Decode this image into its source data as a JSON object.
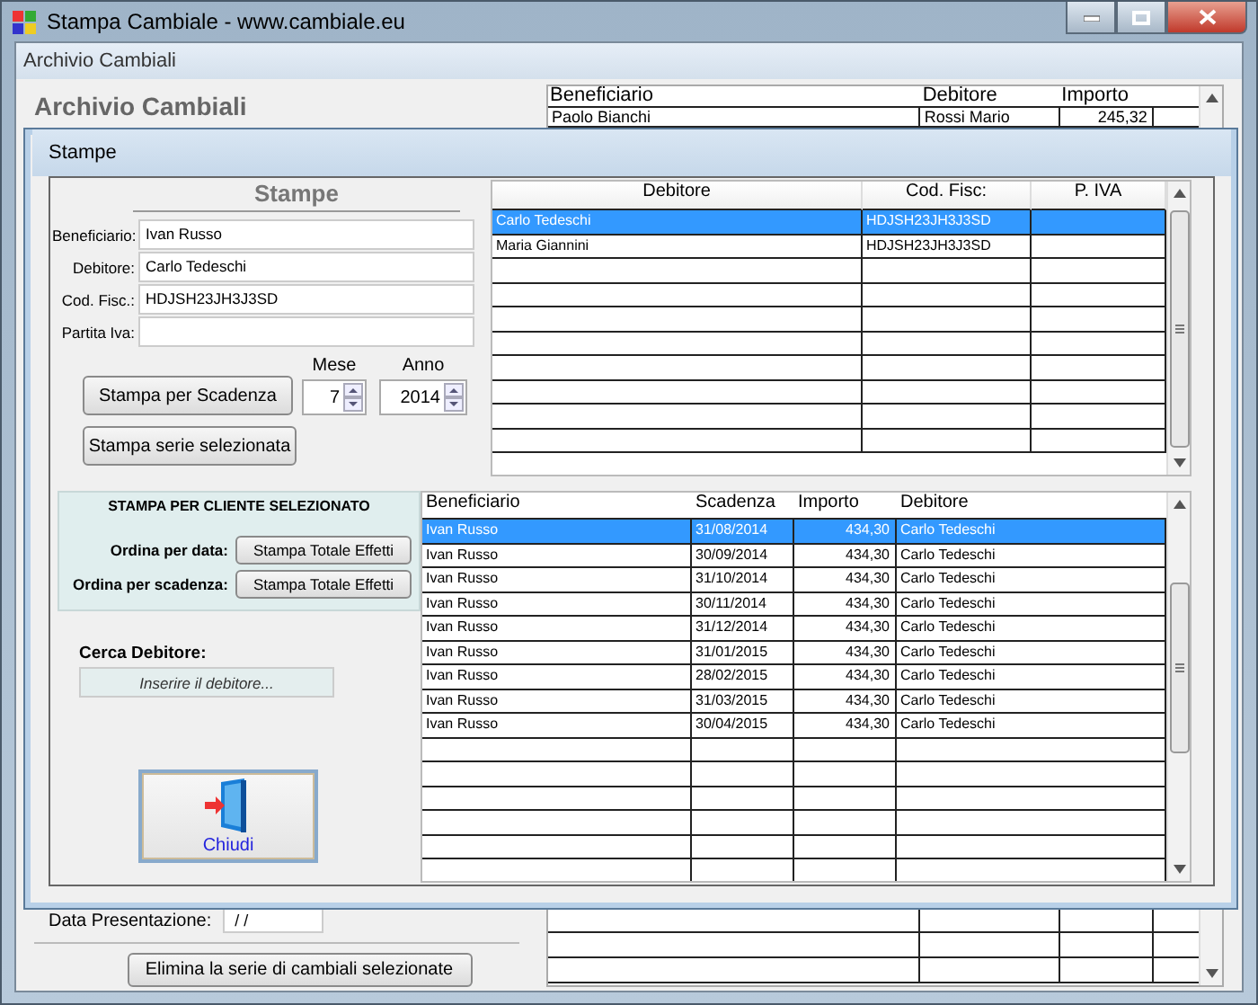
{
  "window": {
    "title": "Stampa Cambiale - www.cambiale.eu"
  },
  "child_window": {
    "title": "Archivio Cambiali",
    "heading": "Archivio Cambiali",
    "archive_table": {
      "columns": [
        "Beneficiario",
        "Debitore",
        "Importo"
      ],
      "rows": [
        {
          "cells": [
            "Paolo Bianchi",
            "Rossi Mario",
            "245,32"
          ]
        }
      ]
    },
    "date_field": {
      "label": "Data Presentazione:",
      "value": "/ /"
    },
    "delete_button": "Elimina la serie di cambiali selezionate"
  },
  "dialog": {
    "title": "Stampe",
    "heading": "Stampe",
    "fields": [
      {
        "label": "Beneficiario:",
        "value": "Ivan Russo"
      },
      {
        "label": "Debitore:",
        "value": "Carlo Tedeschi"
      },
      {
        "label": "Cod. Fisc.:",
        "value": "HDJSH23JH3J3SD"
      },
      {
        "label": "Partita Iva:"
      }
    ],
    "month": {
      "label": "Mese",
      "value": "7"
    },
    "year": {
      "label": "Anno",
      "value": "2014"
    },
    "print_due_button": "Stampa per Scadenza",
    "print_series_button": "Stampa serie selezionata",
    "debtors_table": {
      "columns": [
        "Debitore",
        "Cod. Fisc:",
        "P. IVA"
      ],
      "rows": [
        {
          "cells": [
            "Carlo Tedeschi",
            "HDJSH23JH3J3SD",
            ""
          ],
          "selected": true
        },
        {
          "cells": [
            "Maria Giannini",
            "HDJSH23JH3J3SD",
            ""
          ],
          "selected": false
        }
      ]
    },
    "client_panel": {
      "title": "STAMPA PER CLIENTE SELEZIONATO",
      "rows": [
        {
          "label": "Ordina per data:",
          "button": "Stampa Totale Effetti"
        },
        {
          "label": "Ordina per scadenza:",
          "button": "Stampa Totale Effetti"
        }
      ]
    },
    "search": {
      "label": "Cerca Debitore:",
      "placeholder": "Inserire il debitore..."
    },
    "close_button": "Chiudi",
    "bills_table": {
      "columns": [
        "Beneficiario",
        "Scadenza",
        "Importo",
        "Debitore"
      ],
      "rows": [
        {
          "cells": [
            "Ivan Russo",
            "31/08/2014",
            "434,30",
            "Carlo Tedeschi"
          ],
          "selected": true
        },
        {
          "cells": [
            "Ivan Russo",
            "30/09/2014",
            "434,30",
            "Carlo Tedeschi"
          ],
          "selected": false
        },
        {
          "cells": [
            "Ivan Russo",
            "31/10/2014",
            "434,30",
            "Carlo Tedeschi"
          ],
          "selected": false
        },
        {
          "cells": [
            "Ivan Russo",
            "30/11/2014",
            "434,30",
            "Carlo Tedeschi"
          ],
          "selected": false
        },
        {
          "cells": [
            "Ivan Russo",
            "31/12/2014",
            "434,30",
            "Carlo Tedeschi"
          ],
          "selected": false
        },
        {
          "cells": [
            "Ivan Russo",
            "31/01/2015",
            "434,30",
            "Carlo Tedeschi"
          ],
          "selected": false
        },
        {
          "cells": [
            "Ivan Russo",
            "28/02/2015",
            "434,30",
            "Carlo Tedeschi"
          ],
          "selected": false
        },
        {
          "cells": [
            "Ivan Russo",
            "31/03/2015",
            "434,30",
            "Carlo Tedeschi"
          ],
          "selected": false
        },
        {
          "cells": [
            "Ivan Russo",
            "30/04/2015",
            "434,30",
            "Carlo Tedeschi"
          ],
          "selected": false
        }
      ]
    }
  }
}
